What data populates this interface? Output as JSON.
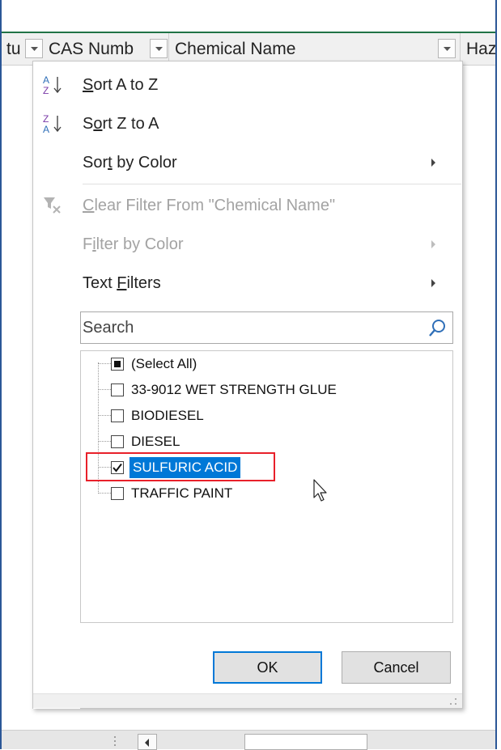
{
  "header": {
    "col_prev_text": "tu",
    "col_cas_label": "CAS Numb",
    "col_chem_label": "Chemical Name",
    "col_next_label": "Haz"
  },
  "menu": {
    "sort_az": {
      "pre": "",
      "u": "S",
      "post": "ort A to Z"
    },
    "sort_za": {
      "pre": "S",
      "u": "o",
      "post": "rt Z to A"
    },
    "sort_color": {
      "pre": "Sor",
      "u": "t",
      "post": " by Color"
    },
    "clear_filter": {
      "pre": "",
      "u": "C",
      "post": "lear Filter From \"Chemical Name\""
    },
    "filter_color": {
      "pre": "F",
      "u": "i",
      "post": "lter by Color"
    },
    "text_filters": {
      "pre": "Text ",
      "u": "F",
      "post": "ilters"
    }
  },
  "search": {
    "placeholder": "Search",
    "value": ""
  },
  "list": {
    "items": [
      {
        "label": "(Select All)",
        "state": "partial"
      },
      {
        "label": "33-9012 WET STRENGTH GLUE",
        "state": "unchecked"
      },
      {
        "label": "BIODIESEL",
        "state": "unchecked"
      },
      {
        "label": "DIESEL",
        "state": "unchecked"
      },
      {
        "label": "SULFURIC ACID",
        "state": "checked"
      },
      {
        "label": "TRAFFIC PAINT",
        "state": "unchecked"
      }
    ]
  },
  "buttons": {
    "ok": "OK",
    "cancel": "Cancel"
  },
  "colors": {
    "selection": "#0078d7",
    "highlight": "#e8202a",
    "header_border": "#217346"
  },
  "icons": [
    "sort-ascending-icon",
    "sort-descending-icon",
    "clear-filter-icon",
    "search-icon",
    "dropdown-arrow-icon",
    "submenu-arrow-icon",
    "mouse-pointer-icon"
  ]
}
